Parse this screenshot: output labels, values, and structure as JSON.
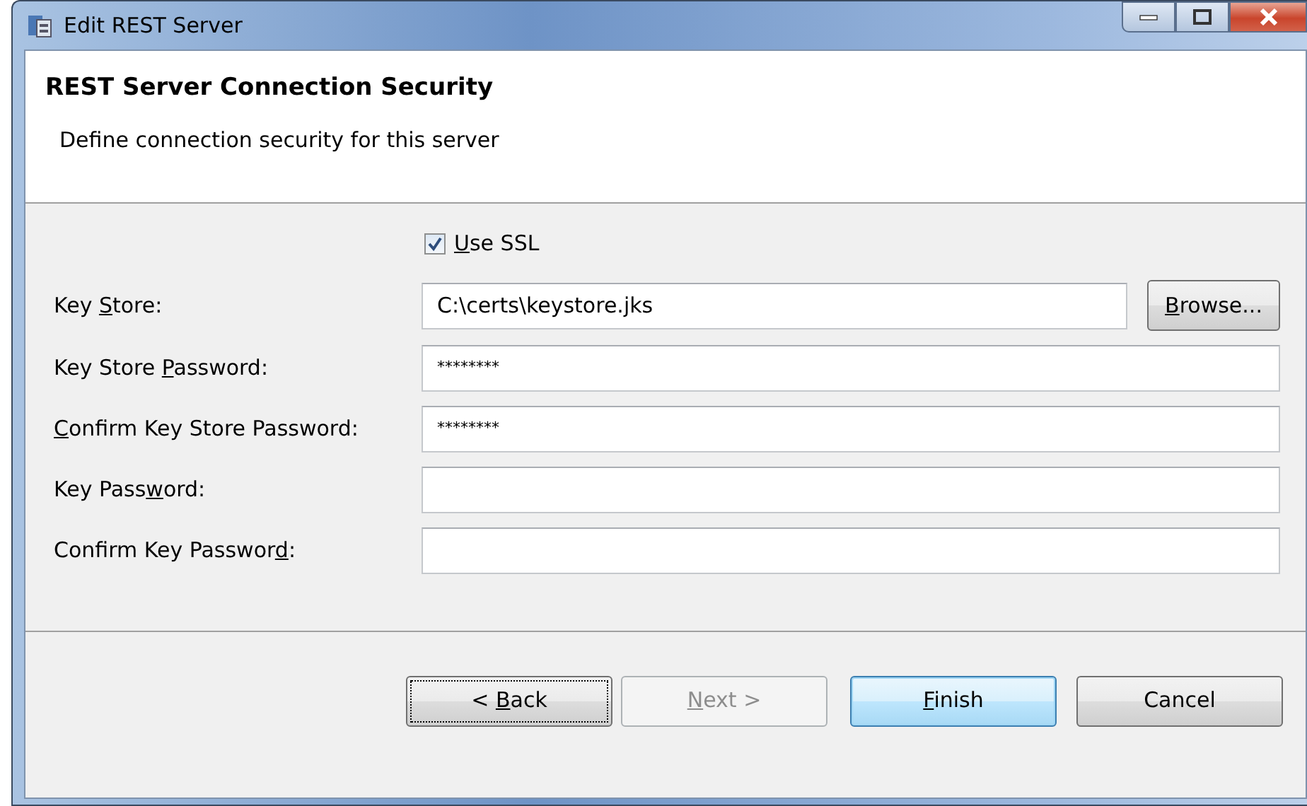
{
  "window": {
    "title": "Edit REST Server"
  },
  "header": {
    "title": "REST Server Connection Security",
    "description": "Define connection security for this server"
  },
  "use_ssl": {
    "label_parts": [
      {
        "text": "U",
        "underlined": true
      },
      {
        "text": "se SSL",
        "underlined": false
      }
    ],
    "checked": true
  },
  "fields": [
    {
      "label_parts": [
        {
          "text": "Key ",
          "underlined": false
        },
        {
          "text": "S",
          "underlined": true
        },
        {
          "text": "tore:",
          "underlined": false
        }
      ],
      "value": "C:\\certs\\keystore.jks",
      "browse": {
        "label_parts": [
          {
            "text": "B",
            "underlined": true
          },
          {
            "text": "rowse...",
            "underlined": false
          }
        ]
      }
    },
    {
      "label_parts": [
        {
          "text": "Key Store ",
          "underlined": false
        },
        {
          "text": "P",
          "underlined": true
        },
        {
          "text": "assword:",
          "underlined": false
        }
      ],
      "value": "********"
    },
    {
      "label_parts": [
        {
          "text": "C",
          "underlined": true
        },
        {
          "text": "onfirm Key Store Password:",
          "underlined": false
        }
      ],
      "value": "********"
    },
    {
      "label_parts": [
        {
          "text": "Key Pass",
          "underlined": false
        },
        {
          "text": "w",
          "underlined": true
        },
        {
          "text": "ord:",
          "underlined": false
        }
      ]
    },
    {
      "label_parts": [
        {
          "text": "Confirm Key Passwor",
          "underlined": false
        },
        {
          "text": "d",
          "underlined": true
        },
        {
          "text": ":",
          "underlined": false
        }
      ]
    }
  ],
  "buttons": [
    {
      "label_parts": [
        {
          "text": "< ",
          "underlined": false
        },
        {
          "text": "B",
          "underlined": true
        },
        {
          "text": "ack",
          "underlined": false
        }
      ],
      "disabled": false,
      "focused": true,
      "default": false
    },
    {
      "label_parts": [
        {
          "text": "N",
          "underlined": true
        },
        {
          "text": "ext >",
          "underlined": false
        }
      ],
      "disabled": true,
      "focused": false,
      "default": false
    },
    {
      "label_parts": [
        {
          "text": "F",
          "underlined": true
        },
        {
          "text": "inish",
          "underlined": false
        }
      ],
      "disabled": false,
      "focused": false,
      "default": true
    },
    {
      "label_parts": [
        {
          "text": "Cancel",
          "underlined": false
        }
      ],
      "disabled": false,
      "focused": false,
      "default": false
    }
  ]
}
